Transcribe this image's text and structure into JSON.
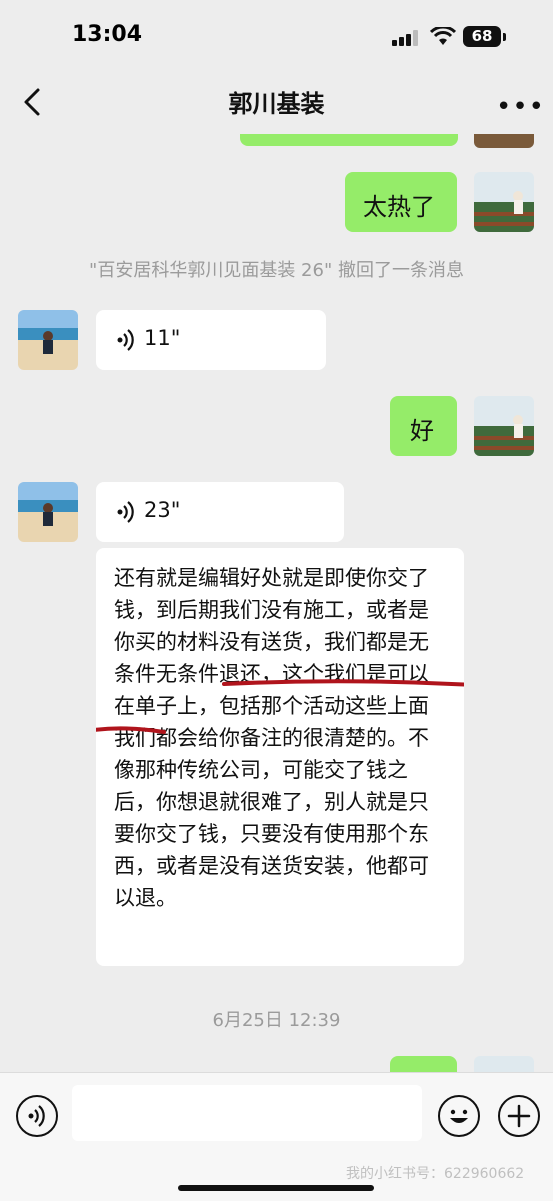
{
  "status": {
    "time": "13:04",
    "battery": "68"
  },
  "header": {
    "title": "郭川基装"
  },
  "messages": {
    "m1_text": "太热了",
    "recall_notice": "\"百安居科华郭川见面基装 26\" 撤回了一条消息",
    "voice1_duration": "11\"",
    "m2_text": "好",
    "voice2_duration": "23\"",
    "long_text": "还有就是编辑好处就是即使你交了钱，到后期我们没有施工，或者是你买的材料没有送货，我们都是无条件无条件退还，这个我们是可以在单子上，包括那个活动这些上面我们都会给你备注的很清楚的。不像那种传统公司，可能交了钱之后，你想退就很难了，别人就是只要你交了钱，只要没有使用那个东西，或者是没有送货安装，他都可以退。",
    "timestamp": "6月25日 12:39"
  },
  "footer": {
    "watermark": "我的小红书号：622960662"
  },
  "icons": {
    "back": "chevron-left-icon",
    "more": "more-icon",
    "voice": "voice-wave-icon",
    "emoji": "emoji-icon",
    "plus": "plus-icon"
  },
  "colors": {
    "sent_bubble": "#95ec69",
    "received_bubble": "#ffffff",
    "background": "#ededed"
  }
}
